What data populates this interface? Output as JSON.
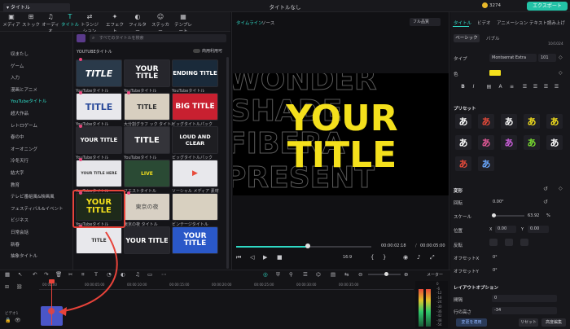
{
  "window": {
    "title": "タイトルなし",
    "coins": "3274",
    "export_label": "エクスポート"
  },
  "toolbar": [
    {
      "label": "メディア",
      "icon": "media-icon"
    },
    {
      "label": "ストック",
      "icon": "stock-icon"
    },
    {
      "label": "オーディオ",
      "icon": "audio-icon"
    },
    {
      "label": "タイトル",
      "icon": "title-icon",
      "active": true
    },
    {
      "label": "トランジション",
      "icon": "transition-icon"
    },
    {
      "label": "エフェクト",
      "icon": "effect-icon"
    },
    {
      "label": "フィルター",
      "icon": "filter-icon"
    },
    {
      "label": "ステッカー",
      "icon": "sticker-icon"
    },
    {
      "label": "テンプレート",
      "icon": "template-icon"
    }
  ],
  "leftnav": {
    "header": "タイトル",
    "items": [
      "収またし",
      "ゲーム",
      "入力",
      "漫画とアニメ",
      "YouTubeタイトル",
      "超大作品",
      "レトロゲーム",
      "春の中",
      "オーオニング",
      "冷冬天行",
      "結大字",
      "教育",
      "テレビ番組風&映画風",
      "フェスティバル&イベント",
      "ビジネス",
      "日常会話",
      "新春",
      "抽象タイトル"
    ],
    "active_index": 4
  },
  "library": {
    "search_placeholder": "すべてのタイトルを検索",
    "section_label": "YOUTUBEタイトル",
    "toggle_label": "商用利用可",
    "cards": [
      {
        "caption": "YouTubeタイトル",
        "text": "TITLE",
        "style": "t1"
      },
      {
        "caption": "YouTubeタイトル",
        "text": "YOUR TITLE",
        "style": "t2"
      },
      {
        "caption": "YouTubeタイトル",
        "text": "ENDING TITLE",
        "style": "t3"
      },
      {
        "caption": "YouTubeタイトル",
        "text": "TITLE",
        "style": "t4"
      },
      {
        "caption": "大分割グラフ ック タイトル",
        "text": "TITLE",
        "style": "t5"
      },
      {
        "caption": "ビッグタイトルパック",
        "text": "BIG TITLE",
        "style": "t6"
      },
      {
        "caption": "YouTubeタイトル",
        "text": "YOUR TITLE",
        "style": "t7"
      },
      {
        "caption": "YouTubeタイトル",
        "text": "TITLE",
        "style": "t8"
      },
      {
        "caption": "ビッグタイトルパック",
        "text": "LOUD AND CLEAR",
        "style": "t9"
      },
      {
        "caption": "YouTubeタイトル",
        "text": "YOUR TITLE HERE",
        "style": "t10"
      },
      {
        "caption": "フエストタイトル",
        "text": "LIVE",
        "style": "t11"
      },
      {
        "caption": "ソーシャル メディア 素材",
        "text": "▶",
        "style": "t12"
      },
      {
        "caption": "YouTubeタイトル",
        "text": "YOUR TITLE",
        "style": "t13"
      },
      {
        "caption": "東京の夜 タイトル",
        "text": "東京の夜",
        "style": "t14"
      },
      {
        "caption": "ビンテージタイトル",
        "text": "",
        "style": "t15"
      },
      {
        "caption": "シンプルなタイトル 素材",
        "text": "TITLE",
        "style": "t16"
      },
      {
        "caption": "YouTubeタイトル",
        "text": "YOUR TITLE",
        "style": "t17"
      },
      {
        "caption": "YouTubeタイトル",
        "text": "YOUR TITLE",
        "style": "t18"
      }
    ]
  },
  "preview": {
    "tab_timeline": "タイムライン",
    "tab_source": "ソース",
    "quality": "フル品質",
    "title_line1": "YOUR",
    "title_line2": "TITLE",
    "bg_words": [
      "WONDER",
      "SHADE",
      "FIBERA",
      "PRESENT"
    ],
    "time_current": "00:00:02:18",
    "time_separator": "/",
    "time_total": "00:00:05:00",
    "ratio": "16:9",
    "progress": 0.53
  },
  "right": {
    "tabs": [
      "タイトル",
      "ビデオ",
      "アニメーション",
      "テキスト読み上げ"
    ],
    "sub_basic": "ベーシック",
    "sub_bubble": "バブル",
    "char_count": "10/1024",
    "type_label": "タイプ",
    "font": "Montserrat Extra",
    "font_size": "101",
    "color_label": "色",
    "color": "#f4e01c",
    "preset_label": "プリセット",
    "presets": [
      {
        "glyph": "あ",
        "color": "#ffffff",
        "bg": "#202026"
      },
      {
        "glyph": "あ",
        "color": "#e84a3a",
        "bg": "#202026"
      },
      {
        "glyph": "あ",
        "color": "#ffffff",
        "bg": "#202026"
      },
      {
        "glyph": "あ",
        "color": "#f4e01c",
        "bg": "#202026"
      },
      {
        "glyph": "あ",
        "color": "#f4e01c",
        "bg": "#202026"
      },
      {
        "glyph": "あ",
        "color": "#ffffff",
        "bg": "#202026"
      },
      {
        "glyph": "あ",
        "color": "#e85a9a",
        "bg": "#202026"
      },
      {
        "glyph": "あ",
        "color": "#d060e0",
        "bg": "#202026"
      },
      {
        "glyph": "あ",
        "color": "#7ae030",
        "bg": "#202026"
      },
      {
        "glyph": "あ",
        "color": "#ffffff",
        "bg": "#202026"
      },
      {
        "glyph": "あ",
        "color": "#e84a3a",
        "bg": "#202026"
      },
      {
        "glyph": "あ",
        "color": "#6aa8ff",
        "bg": "#202026"
      }
    ],
    "transform_label": "変形",
    "rotate_label": "回転",
    "rotate_value": "0.00°",
    "scale_label": "スケール",
    "scale_value": "63.92",
    "scale_unit": "%",
    "position_label": "位置",
    "pos_x_label": "X",
    "pos_x": "0.00",
    "pos_y_label": "Y",
    "pos_y": "0.00",
    "flip_label": "反転",
    "offset_x_label": "オフセットX",
    "offset_x": "0°",
    "offset_y_label": "オフセットY",
    "offset_y": "0°",
    "layout_label": "レイアウトオプション",
    "spacing_label": "間隔",
    "spacing_value": "0",
    "line_height_label": "行の高さ",
    "line_height_value": "-34",
    "apply_all": "変更を適用",
    "reset": "リセット",
    "advanced": "高度編集"
  },
  "timeline": {
    "ticks": [
      "00:00:00",
      "00:00:05:00",
      "00:00:10:00",
      "00:00:15:00",
      "00:00:20:00",
      "00:00:25:00",
      "00:00:30:00",
      "00:00:35:00"
    ],
    "track_label": "ビデオ1",
    "meter_label": "メーター",
    "meter_scale": [
      "0",
      "-6",
      "-12",
      "-18",
      "-24",
      "-30",
      "-36",
      "-42",
      "-48",
      "-54"
    ]
  }
}
